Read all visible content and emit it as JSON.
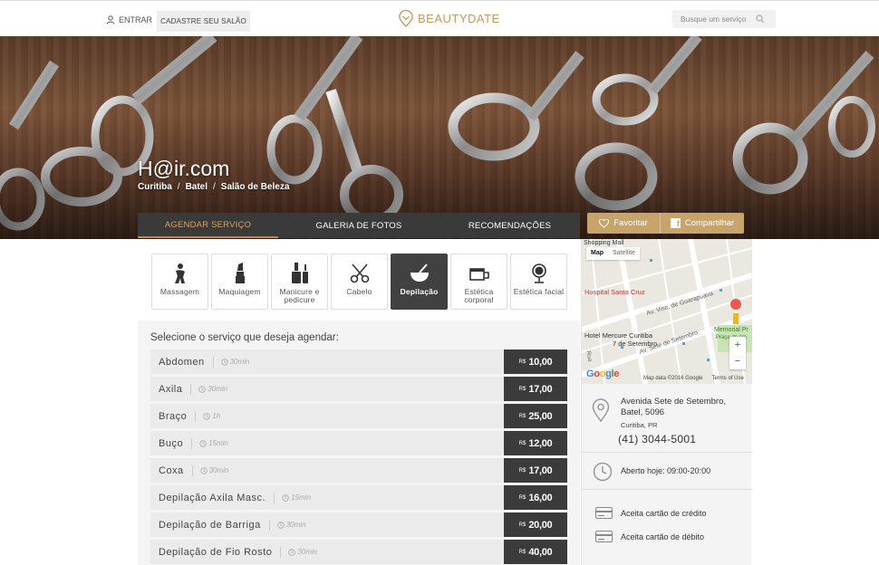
{
  "header": {
    "login_label": "ENTRAR",
    "register_label": "CADASTRE SEU SALÃO",
    "logo_part1": "BEAUTY",
    "logo_part2": "DATE",
    "search_placeholder": "Busque um serviço"
  },
  "salon": {
    "name": "H@ir.com",
    "breadcrumb": [
      "Curitiba",
      "Batel",
      "Salão de Beleza"
    ]
  },
  "tabs": [
    {
      "label": "AGENDAR SERVIÇO",
      "active": true
    },
    {
      "label": "GALERIA DE FOTOS",
      "active": false
    },
    {
      "label": "RECOMENDAÇÕES",
      "active": false
    }
  ],
  "actions": {
    "favorite_label": "Favoritar",
    "share_label": "Compartilhar"
  },
  "categories": [
    {
      "label": "Massagem",
      "icon": "massage-icon",
      "active": false
    },
    {
      "label": "Maquiagem",
      "icon": "lipstick-icon",
      "active": false
    },
    {
      "label": "Manicure e pedicure",
      "icon": "nail-polish-icon",
      "active": false
    },
    {
      "label": "Cabelo",
      "icon": "scissors-icon",
      "active": false
    },
    {
      "label": "Depilação",
      "icon": "wax-bowl-icon",
      "active": true
    },
    {
      "label": "Estética corporal",
      "icon": "body-treatment-icon",
      "active": false
    },
    {
      "label": "Estética facial",
      "icon": "mirror-icon",
      "active": false
    }
  ],
  "services_heading": "Selecione o serviço que deseja agendar:",
  "currency": "R$",
  "services": [
    {
      "name": "Abdomen",
      "duration": "30min",
      "price": "10,00"
    },
    {
      "name": "Axila",
      "duration": "30min",
      "price": "17,00"
    },
    {
      "name": "Braço",
      "duration": "1h",
      "price": "25,00"
    },
    {
      "name": "Buço",
      "duration": "15min",
      "price": "12,00"
    },
    {
      "name": "Coxa",
      "duration": "30min",
      "price": "17,00"
    },
    {
      "name": "Depilação Axila Masc.",
      "duration": "15min",
      "price": "16,00"
    },
    {
      "name": "Depilação de Barriga",
      "duration": "30min",
      "price": "20,00"
    },
    {
      "name": "Depilação de Fio Rosto",
      "duration": "30min",
      "price": "40,00"
    }
  ],
  "map": {
    "map_label": "Map",
    "satellite_label": "Satellite",
    "place_mall": "Shopping Mall",
    "place_hospital": "Hospital Santa Cruz",
    "place_hotel_1": "Hotel Mercure Curitiba",
    "place_hotel_2": "7 de Setembro",
    "street_1": "Av. Visc. de Guarapuava",
    "street_2": "Av. Sete de Setembro",
    "place_memorial": "Memorial Pr",
    "place_praca": "Praça de Ale",
    "street_rua": "Rua",
    "google_label": "Google",
    "data_credit": "Map data ©2016 Google",
    "terms": "Terms of Use",
    "zoom_in": "+",
    "zoom_out": "−"
  },
  "contact": {
    "address": "Avenida Sete de Setembro, Batel, 5096",
    "city": "Curitiba, PR",
    "phone": "(41) 3044-5001",
    "hours": "Aberto hoje: 09:00-20:00",
    "credit": "Aceita cartão de crédito",
    "debit": "Aceita cartão de débito"
  },
  "colors": {
    "accent": "#c8a36a",
    "logo": "#c49a5e",
    "tab_bar": "#3a3a3a",
    "active_tab_text": "#d9a25b",
    "price_bg": "#3b3b3b"
  }
}
